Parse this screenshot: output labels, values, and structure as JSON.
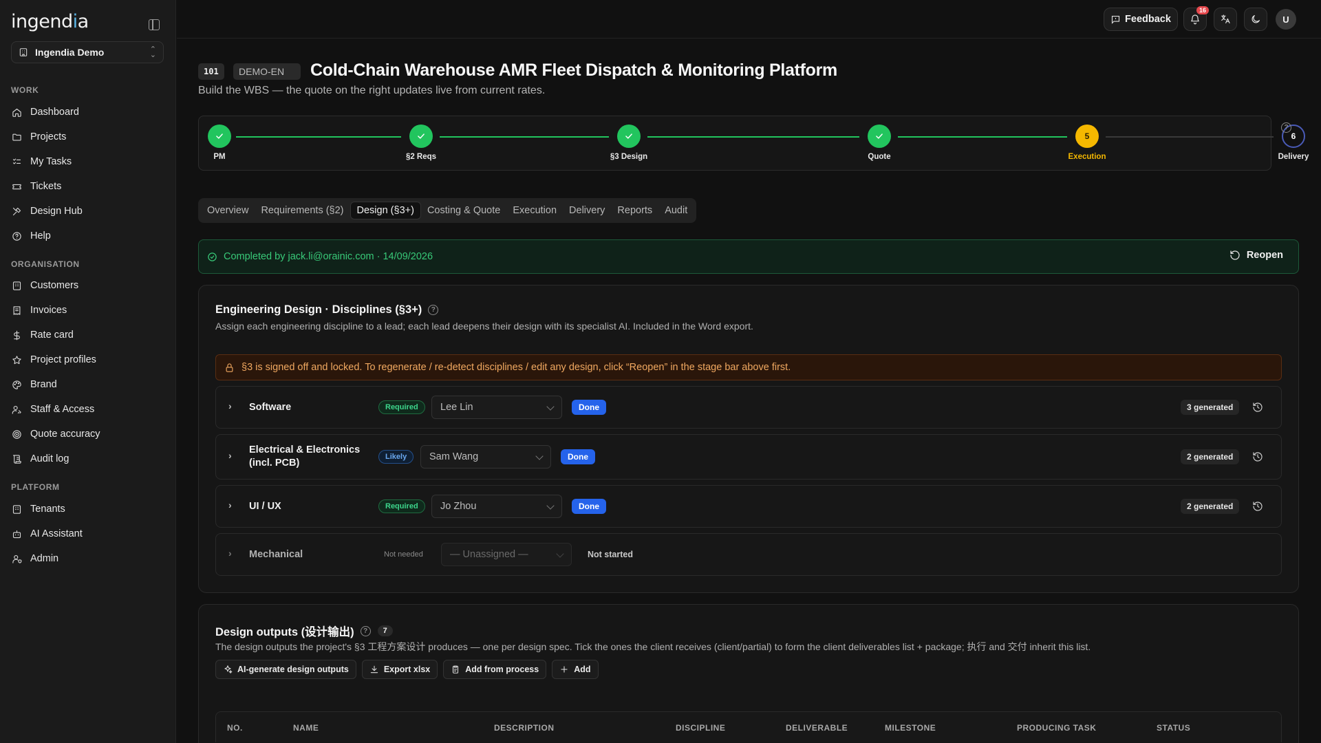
{
  "app": {
    "brand_text": "ingendia",
    "tenant": "Ingendia Demo"
  },
  "sidebar": {
    "sections": [
      {
        "label": "WORK",
        "items": [
          {
            "label": "Dashboard",
            "icon": "home-icon"
          },
          {
            "label": "Projects",
            "icon": "folder-icon"
          },
          {
            "label": "My Tasks",
            "icon": "checklist-icon"
          },
          {
            "label": "Tickets",
            "icon": "ticket-icon"
          },
          {
            "label": "Design Hub",
            "icon": "tools-icon"
          },
          {
            "label": "Help",
            "icon": "help-icon"
          }
        ]
      },
      {
        "label": "ORGANISATION",
        "items": [
          {
            "label": "Customers",
            "icon": "building-icon"
          },
          {
            "label": "Invoices",
            "icon": "receipt-icon"
          },
          {
            "label": "Rate card",
            "icon": "dollar-icon"
          },
          {
            "label": "Project profiles",
            "icon": "star-icon"
          },
          {
            "label": "Brand",
            "icon": "palette-icon"
          },
          {
            "label": "Staff & Access",
            "icon": "user-key-icon"
          },
          {
            "label": "Quote accuracy",
            "icon": "target-icon"
          },
          {
            "label": "Audit log",
            "icon": "scroll-icon"
          }
        ]
      },
      {
        "label": "PLATFORM",
        "items": [
          {
            "label": "Tenants",
            "icon": "building-icon"
          },
          {
            "label": "AI Assistant",
            "icon": "bot-icon"
          },
          {
            "label": "Admin",
            "icon": "user-shield-icon"
          }
        ]
      }
    ]
  },
  "topbar": {
    "feedback_label": "Feedback",
    "notification_count": "16",
    "avatar_initial": "U"
  },
  "project": {
    "number": "101",
    "code": "DEMO-EN",
    "title": "Cold-Chain Warehouse AMR Fleet Dispatch & Monitoring Platform",
    "subtitle": "Build the WBS — the quote on the right updates live from current rates."
  },
  "stepper": {
    "steps": [
      {
        "label": "PM",
        "state": "done",
        "number": ""
      },
      {
        "label": "§2 Reqs",
        "state": "done",
        "number": ""
      },
      {
        "label": "§3 Design",
        "state": "done",
        "number": ""
      },
      {
        "label": "Quote",
        "state": "done",
        "number": ""
      },
      {
        "label": "Execution",
        "state": "current",
        "number": "5"
      },
      {
        "label": "Delivery",
        "state": "todo",
        "number": "6"
      }
    ]
  },
  "tabs": [
    "Overview",
    "Requirements (§2)",
    "Design (§3+)",
    "Costing & Quote",
    "Execution",
    "Delivery",
    "Reports",
    "Audit"
  ],
  "active_tab": "Design (§3+)",
  "completion": {
    "text": "Completed by jack.li@orainic.com · 14/09/2026",
    "reopen_label": "Reopen"
  },
  "disciplines_card": {
    "title": "Engineering Design · Disciplines (§3+)",
    "description": "Assign each engineering discipline to a lead; each lead deepens their design with its specialist AI. Included in the Word export.",
    "lock_message": "§3 is signed off and locked. To regenerate / re-detect disciplines / edit any design, click “Reopen” in the stage bar above first.",
    "rows": [
      {
        "name": "Software",
        "tag": "Required",
        "lead": "Lee Lin",
        "status": "Done",
        "generated": "3 generated"
      },
      {
        "name": "Electrical & Electronics (incl. PCB)",
        "tag": "Likely",
        "lead": "Sam Wang",
        "status": "Done",
        "generated": "2 generated"
      },
      {
        "name": "UI / UX",
        "tag": "Required",
        "lead": "Jo Zhou",
        "status": "Done",
        "generated": "2 generated"
      },
      {
        "name": "Mechanical",
        "tag": "Not needed",
        "lead": "— Unassigned —",
        "status": "Not started",
        "generated": ""
      }
    ]
  },
  "outputs_card": {
    "title": "Design outputs (设计输出)",
    "count": "7",
    "description": "The design outputs the project's §3 工程方案设计 produces — one per design spec. Tick the ones the client receives (client/partial) to form the client deliverables list + package; 执行 and 交付 inherit this list.",
    "actions": [
      "AI-generate design outputs",
      "Export xlsx",
      "Add from process",
      "Add"
    ],
    "columns": [
      "NO.",
      "NAME",
      "DESCRIPTION",
      "DISCIPLINE",
      "DELIVERABLE",
      "MILESTONE",
      "PRODUCING TASK",
      "STATUS"
    ]
  },
  "colors": {
    "success": "#22c55e",
    "current_step": "#f5b800",
    "status_done": "#2563eb",
    "warning_text": "#f0a860"
  }
}
